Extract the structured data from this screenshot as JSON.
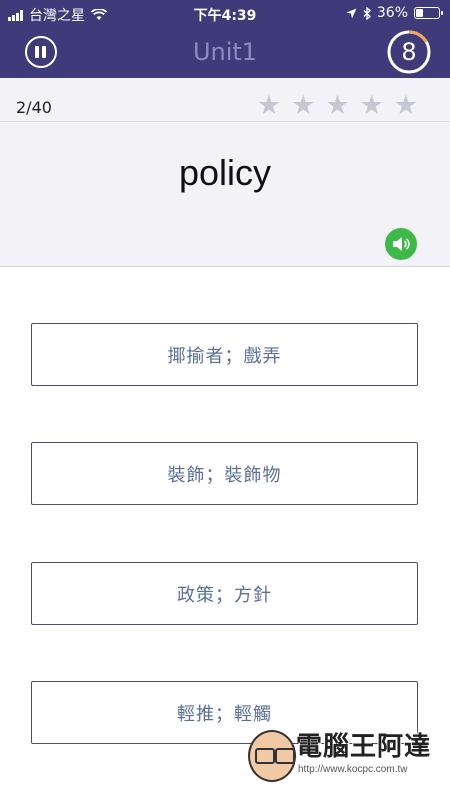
{
  "status_bar": {
    "carrier": "台灣之星",
    "time": "下午4:39",
    "battery": "36%",
    "battery_level": 0.36
  },
  "nav": {
    "title": "Unit1",
    "timer": "8",
    "pause_icon": "pause-icon"
  },
  "quiz": {
    "progress": "2/40",
    "stars_total": 5,
    "stars_filled": 0,
    "word": "policy"
  },
  "options": [
    {
      "label": "揶揄者；戲弄"
    },
    {
      "label": "裝飾；裝飾物"
    },
    {
      "label": "政策；方針"
    },
    {
      "label": "輕推；輕觸"
    }
  ],
  "watermark": {
    "title": "電腦王阿達",
    "url": "http://www.kocpc.com.tw"
  },
  "colors": {
    "header": "#3f3a7a",
    "sound_button": "#3fb84a",
    "option_text": "#5a6f9a"
  }
}
